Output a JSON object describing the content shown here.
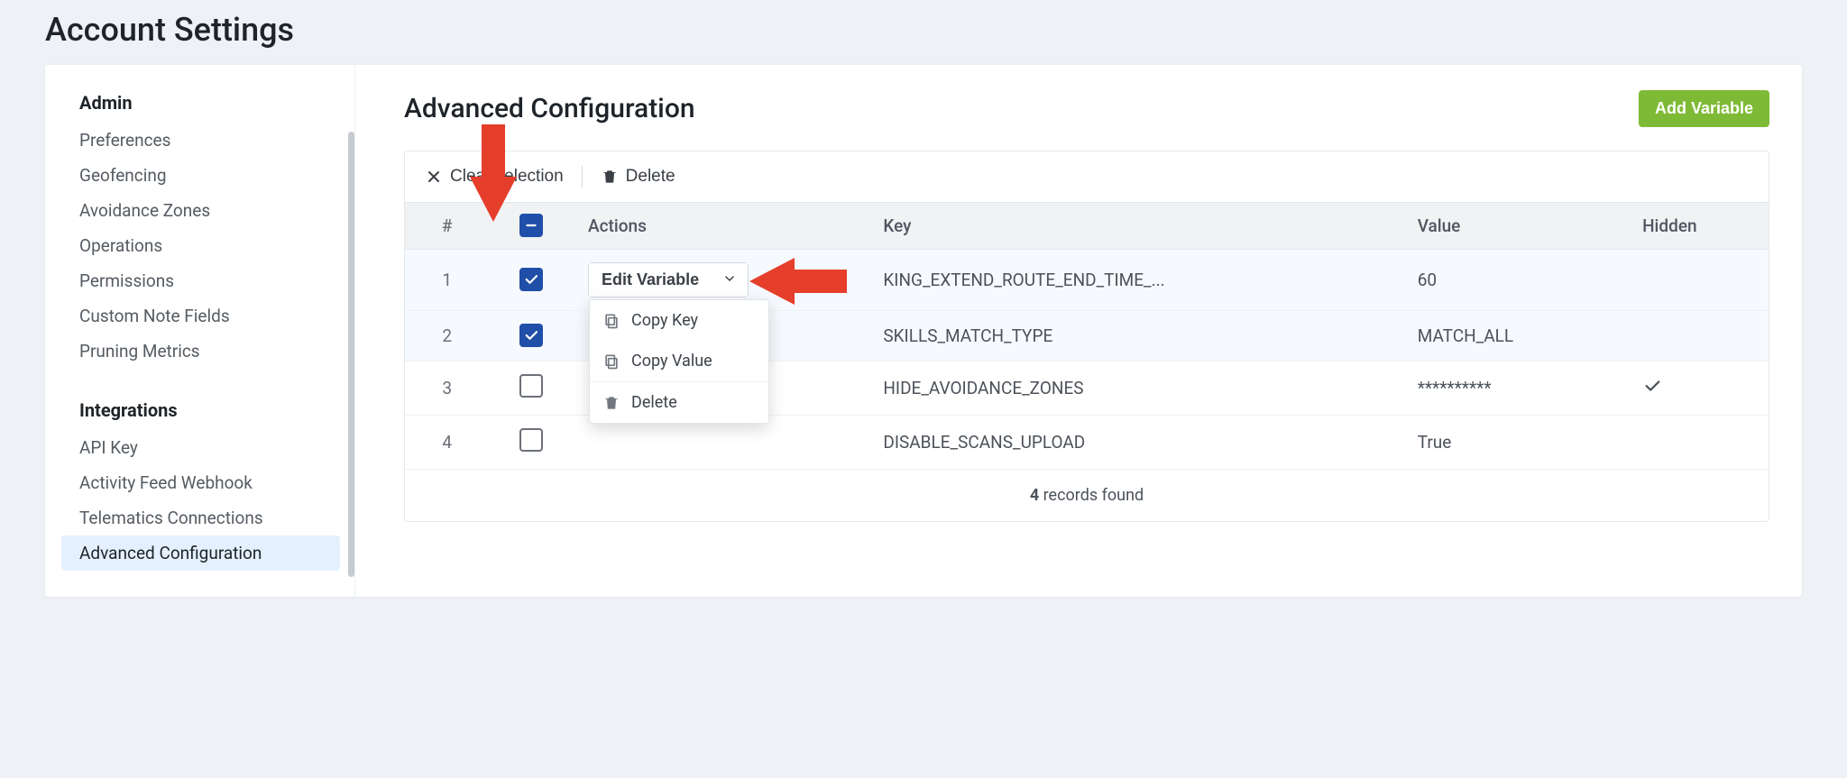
{
  "page_title": "Account Settings",
  "sidebar": {
    "groups": [
      {
        "title": "Admin",
        "items": [
          {
            "label": "Preferences",
            "active": false
          },
          {
            "label": "Geofencing",
            "active": false
          },
          {
            "label": "Avoidance Zones",
            "active": false
          },
          {
            "label": "Operations",
            "active": false
          },
          {
            "label": "Permissions",
            "active": false
          },
          {
            "label": "Custom Note Fields",
            "active": false
          },
          {
            "label": "Pruning Metrics",
            "active": false
          }
        ]
      },
      {
        "title": "Integrations",
        "items": [
          {
            "label": "API Key",
            "active": false
          },
          {
            "label": "Activity Feed Webhook",
            "active": false
          },
          {
            "label": "Telematics Connections",
            "active": false
          },
          {
            "label": "Advanced Configuration",
            "active": true
          }
        ]
      }
    ]
  },
  "main": {
    "title": "Advanced Configuration",
    "add_button": "Add Variable"
  },
  "toolbar": {
    "clear_selection": "Clear selection",
    "delete": "Delete"
  },
  "table": {
    "headers": {
      "idx": "#",
      "actions": "Actions",
      "key": "Key",
      "value": "Value",
      "hidden": "Hidden"
    },
    "edit_label": "Edit Variable",
    "rows": [
      {
        "n": "1",
        "checked": true,
        "key": "KING_EXTEND_ROUTE_END_TIME_...",
        "value": "60",
        "hidden": false
      },
      {
        "n": "2",
        "checked": true,
        "key": "SKILLS_MATCH_TYPE",
        "value": "MATCH_ALL",
        "hidden": false
      },
      {
        "n": "3",
        "checked": false,
        "key": "HIDE_AVOIDANCE_ZONES",
        "value": "**********",
        "hidden": true
      },
      {
        "n": "4",
        "checked": false,
        "key": "DISABLE_SCANS_UPLOAD",
        "value": "True",
        "hidden": false
      }
    ]
  },
  "dropdown": {
    "copy_key": "Copy Key",
    "copy_value": "Copy Value",
    "delete": "Delete"
  },
  "footer": {
    "count": "4",
    "suffix": " records found"
  },
  "colors": {
    "accent_green": "#7fba36",
    "checkbox_blue": "#1f4fa8",
    "arrow_red": "#e53e2b"
  }
}
